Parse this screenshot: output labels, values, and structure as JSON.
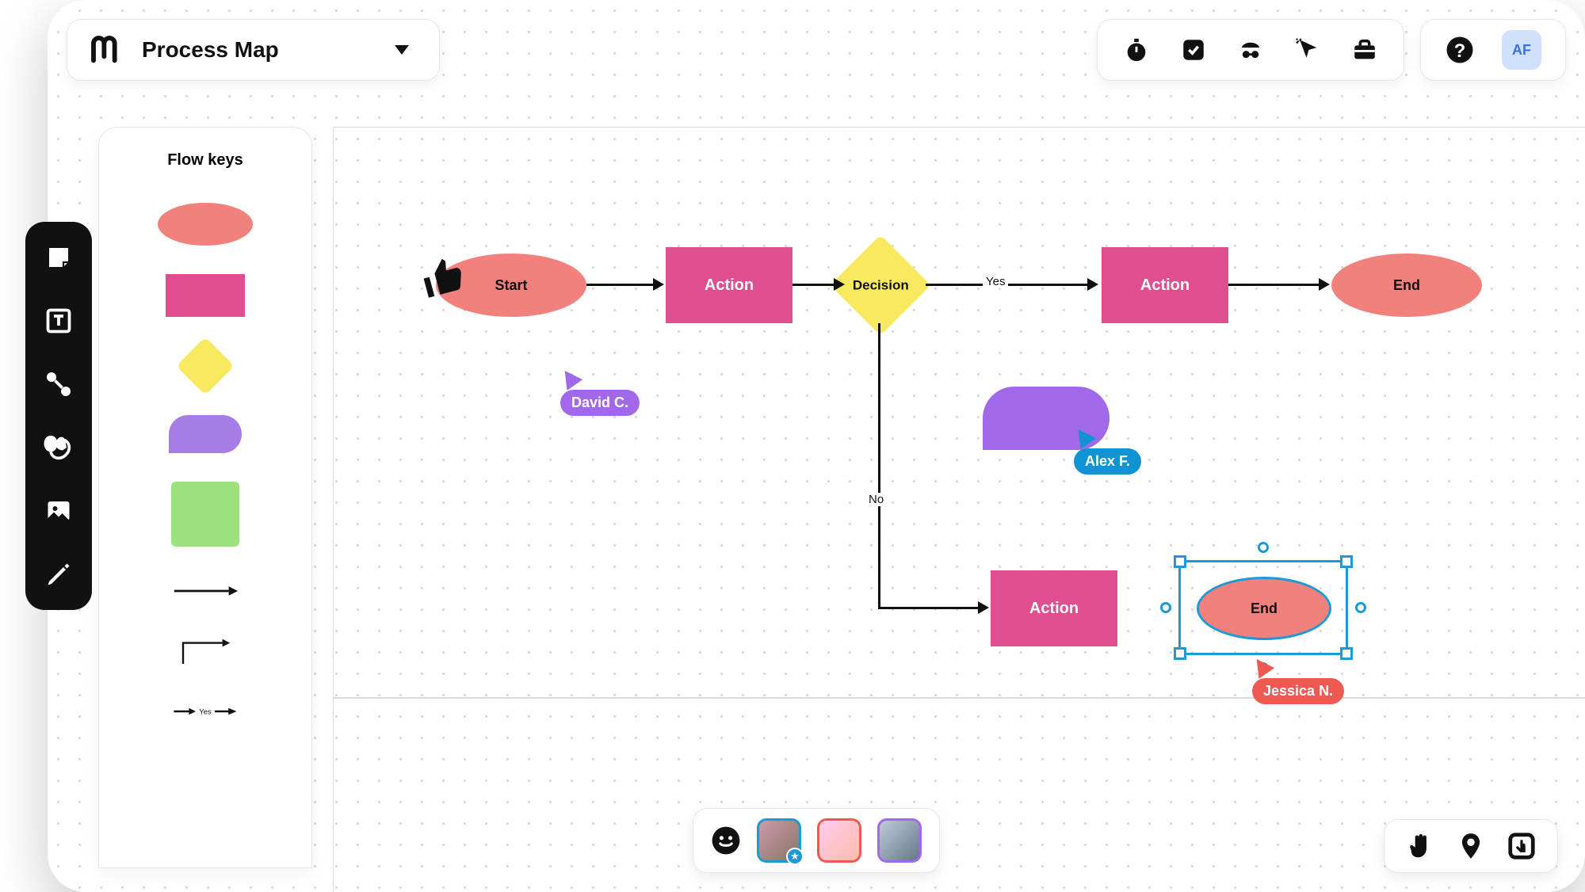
{
  "header": {
    "title": "Process Map",
    "user_initials": "AF"
  },
  "panel": {
    "title": "Flow keys",
    "arrow_yes_label": "Yes"
  },
  "toolbar_icons": [
    "note",
    "text",
    "connector",
    "shape",
    "image",
    "pencil"
  ],
  "top_icons": [
    "timer",
    "checkbox",
    "incognito",
    "cursor",
    "toolbox",
    "help"
  ],
  "flow": {
    "start": "Start",
    "action1": "Action",
    "decision": "Decision",
    "action2": "Action",
    "end": "End",
    "action3": "Action",
    "end2": "End",
    "yes": "Yes",
    "no": "No"
  },
  "cursors": {
    "david": "David C.",
    "alex": "Alex F.",
    "jessica": "Jessica N."
  }
}
